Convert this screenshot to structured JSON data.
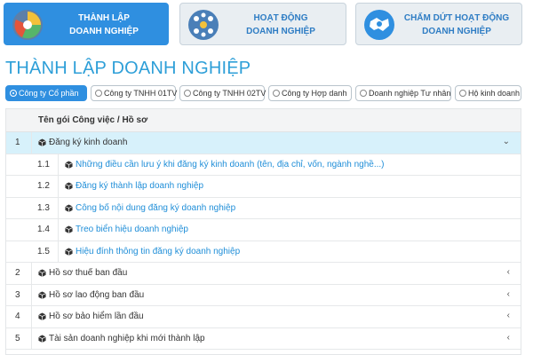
{
  "nav": [
    {
      "line1": "THÀNH LẬP",
      "line2": "DOANH NGHIỆP",
      "icon": "pie-chart-icon",
      "active": true
    },
    {
      "line1": "HOẠT ĐỘNG",
      "line2": "DOANH NGHIỆP",
      "icon": "team-network-icon",
      "active": false
    },
    {
      "line1": "CHẤM DỨT HOẠT ĐỘNG",
      "line2": "DOANH NGHIỆP",
      "icon": "handshake-icon",
      "active": false
    }
  ],
  "page_title": "THÀNH LẬP DOANH NGHIỆP",
  "company_types": [
    {
      "label": "Công ty Cổ phần",
      "selected": true
    },
    {
      "label": "Công ty TNHH 01TV",
      "selected": false
    },
    {
      "label": "Công ty TNHH 02TV",
      "selected": false
    },
    {
      "label": "Công ty Hợp danh",
      "selected": false
    },
    {
      "label": "Doanh nghiệp Tư nhân",
      "selected": false
    },
    {
      "label": "Hộ kinh doanh",
      "selected": false
    }
  ],
  "table": {
    "header": "Tên gói Công việc / Hồ sơ",
    "rows": [
      {
        "num": "1",
        "text": "Đăng ký kinh doanh",
        "expanded": true,
        "chevron": "⌄"
      },
      {
        "num": "1.1",
        "text": "Những điều cần lưu ý khi đăng ký kinh doanh (tên, địa chỉ, vốn, ngành nghề...)",
        "sub": true
      },
      {
        "num": "1.2",
        "text": "Đăng ký thành lập doanh nghiệp",
        "sub": true
      },
      {
        "num": "1.3",
        "text": "Công bố nội dung đăng ký doanh nghiệp",
        "sub": true
      },
      {
        "num": "1.4",
        "text": "Treo biển hiệu doanh nghiệp",
        "sub": true
      },
      {
        "num": "1.5",
        "text": "Hiệu đính thông tin đăng ký doanh nghiệp",
        "sub": true
      },
      {
        "num": "2",
        "text": "Hồ sơ thuế ban đầu",
        "chevron": "‹"
      },
      {
        "num": "3",
        "text": "Hồ sơ lao động ban đầu",
        "chevron": "‹"
      },
      {
        "num": "4",
        "text": "Hồ sơ bảo hiểm lần đầu",
        "chevron": "‹"
      },
      {
        "num": "5",
        "text": "Tài sản doanh nghiệp khi mới thành lập",
        "chevron": "‹"
      }
    ]
  },
  "colors": {
    "accent": "#2f8fe0",
    "title": "#2e9fd8",
    "link": "#1f8ed8",
    "expanded_row": "#d7f1fb"
  }
}
